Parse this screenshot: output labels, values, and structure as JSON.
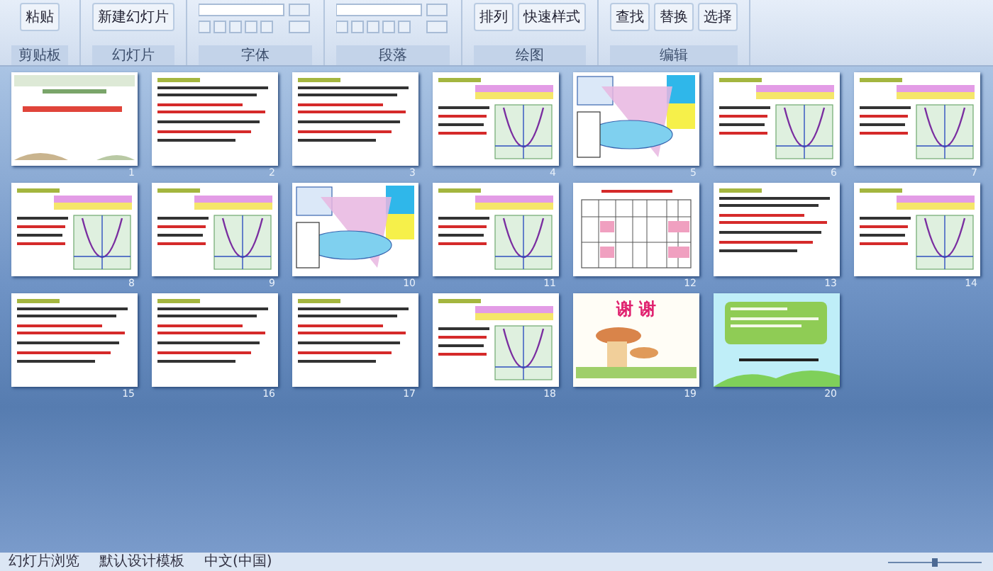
{
  "ribbon": {
    "groups": [
      {
        "label": "剪贴板",
        "buttons": [
          "粘贴"
        ]
      },
      {
        "label": "幻灯片",
        "buttons": [
          "新建幻灯片"
        ]
      },
      {
        "label": "字体"
      },
      {
        "label": "段落"
      },
      {
        "label": "绘图",
        "buttons": [
          "排列",
          "快速样式"
        ]
      },
      {
        "label": "编辑",
        "buttons": [
          "查找",
          "替换",
          "选择"
        ]
      }
    ]
  },
  "slides": [
    {
      "number": "1",
      "kind": "title"
    },
    {
      "number": "2",
      "kind": "text"
    },
    {
      "number": "3",
      "kind": "text"
    },
    {
      "number": "4",
      "kind": "graph"
    },
    {
      "number": "5",
      "kind": "picture"
    },
    {
      "number": "6",
      "kind": "graph"
    },
    {
      "number": "7",
      "kind": "graph"
    },
    {
      "number": "8",
      "kind": "graph"
    },
    {
      "number": "9",
      "kind": "graph"
    },
    {
      "number": "10",
      "kind": "picture"
    },
    {
      "number": "11",
      "kind": "graph"
    },
    {
      "number": "12",
      "kind": "table"
    },
    {
      "number": "13",
      "kind": "text"
    },
    {
      "number": "14",
      "kind": "graph"
    },
    {
      "number": "15",
      "kind": "text"
    },
    {
      "number": "16",
      "kind": "text"
    },
    {
      "number": "17",
      "kind": "text"
    },
    {
      "number": "18",
      "kind": "graph"
    },
    {
      "number": "19",
      "kind": "thanks",
      "title": "谢 谢"
    },
    {
      "number": "20",
      "kind": "card"
    }
  ],
  "status_bar": [
    "幻灯片浏览",
    "默认设计模板",
    "中文(中国)"
  ]
}
